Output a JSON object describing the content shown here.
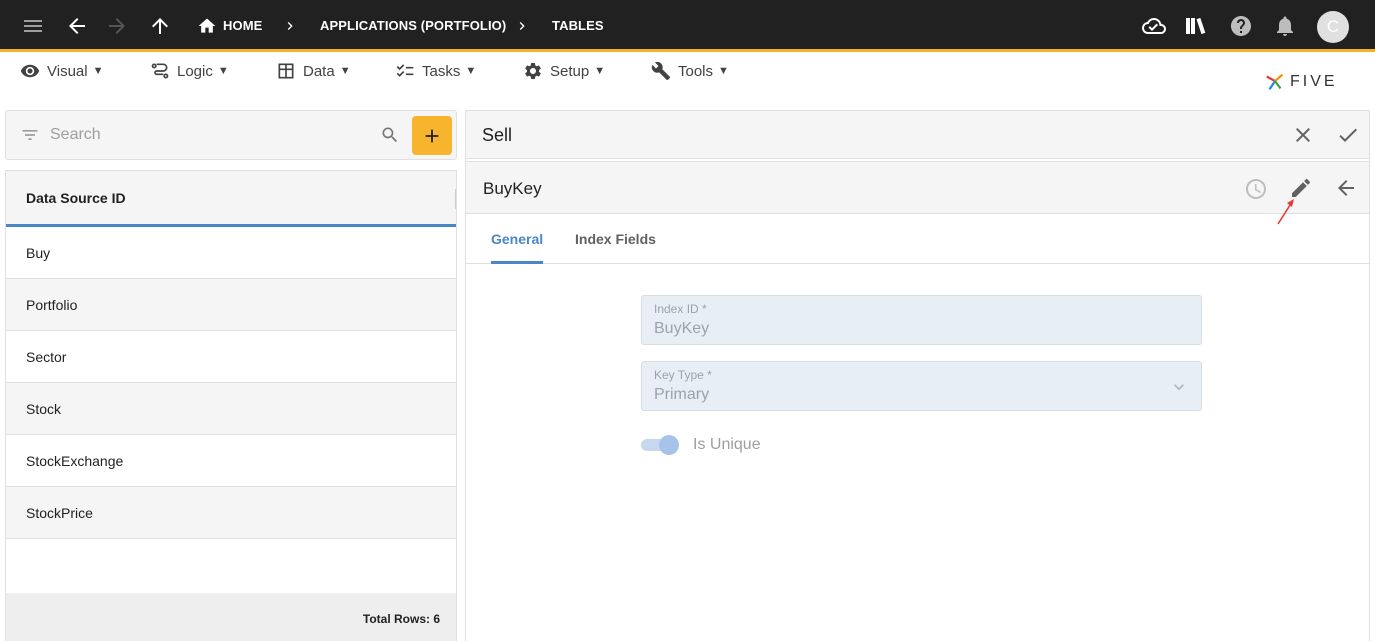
{
  "topbar": {
    "breadcrumbs": [
      "HOME",
      "APPLICATIONS (PORTFOLIO)",
      "TABLES"
    ],
    "avatar_initial": "C",
    "icons": [
      "menu-icon",
      "back-arrow-icon",
      "forward-arrow-icon",
      "up-arrow-icon",
      "home-icon",
      "cloud-check-icon",
      "library-icon",
      "help-icon",
      "bell-icon"
    ],
    "accent_color": "#f5b324"
  },
  "menubar": {
    "items": [
      {
        "label": "Visual",
        "icon": "eye-icon"
      },
      {
        "label": "Logic",
        "icon": "logic-icon"
      },
      {
        "label": "Data",
        "icon": "table-icon"
      },
      {
        "label": "Tasks",
        "icon": "tasks-icon"
      },
      {
        "label": "Setup",
        "icon": "gear-icon"
      },
      {
        "label": "Tools",
        "icon": "tools-icon"
      }
    ],
    "logo_text": "FIVE"
  },
  "left": {
    "search_placeholder": "Search",
    "column_header": "Data Source ID",
    "rows": [
      "Buy",
      "Portfolio",
      "Sector",
      "Stock",
      "StockExchange",
      "StockPrice"
    ],
    "footer": "Total Rows: 6",
    "add_button_color": "#f7b42c"
  },
  "right": {
    "title": "Sell",
    "record_title": "BuyKey",
    "tabs": [
      "General",
      "Index Fields"
    ],
    "active_tab": "General",
    "fields": {
      "index_id": {
        "label": "Index ID *",
        "value": "BuyKey"
      },
      "key_type": {
        "label": "Key Type *",
        "value": "Primary"
      }
    },
    "toggle": {
      "label": "Is Unique",
      "on": true
    },
    "tab_color": "#4a86c8"
  }
}
